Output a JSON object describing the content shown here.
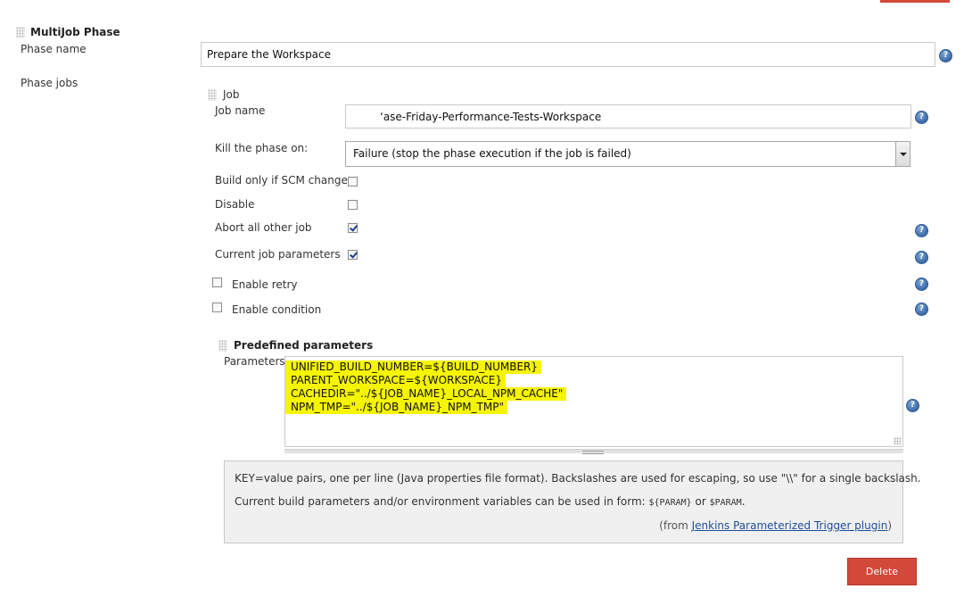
{
  "phase": {
    "section_title": "MultiJob Phase",
    "phase_name_label": "Phase name",
    "phase_name_value": "Prepare the Workspace",
    "phase_jobs_label": "Phase jobs"
  },
  "job": {
    "section_title": "Job",
    "job_name_label": "Job name",
    "job_name_value": "‘ase-Friday-Performance-Tests-Workspace",
    "kill_label": "Kill the phase on:",
    "kill_value": "Failure (stop the phase execution if the job is failed)",
    "build_only_scm_label": "Build only if SCM changes",
    "disable_label": "Disable",
    "abort_label": "Abort all other job",
    "current_params_label": "Current job parameters",
    "enable_retry_label": "Enable retry",
    "enable_condition_label": "Enable condition",
    "checkboxes": {
      "build_only_scm": false,
      "disable": false,
      "abort": true,
      "current_params": true,
      "enable_retry": false,
      "enable_condition": false
    }
  },
  "predefined": {
    "section_title": "Predefined parameters",
    "parameters_label": "Parameters",
    "lines": [
      "UNIFIED_BUILD_NUMBER=${BUILD_NUMBER}",
      "PARENT_WORKSPACE=${WORKSPACE}",
      "CACHEDIR=\"../${JOB_NAME}_LOCAL_NPM_CACHE\"",
      "NPM_TMP=\"../${JOB_NAME}_NPM_TMP\""
    ],
    "highlight_color": "#f5f500"
  },
  "help": {
    "line1": "KEY=value pairs, one per line (Java properties file format). Backslashes are used for escaping, so use \"\\\\\" for a single backslash.",
    "line2_prefix": "Current build parameters and/or environment variables can be used in form: ",
    "code1": "${PARAM}",
    "or": " or ",
    "code2": "$PARAM",
    "period": ".",
    "from_prefix": "(from ",
    "plugin_link": "Jenkins Parameterized Trigger plugin",
    "from_suffix": ")"
  },
  "buttons": {
    "delete_label": "Delete",
    "delete_color": "#d24939"
  },
  "icons": {
    "help_glyph": "?"
  }
}
